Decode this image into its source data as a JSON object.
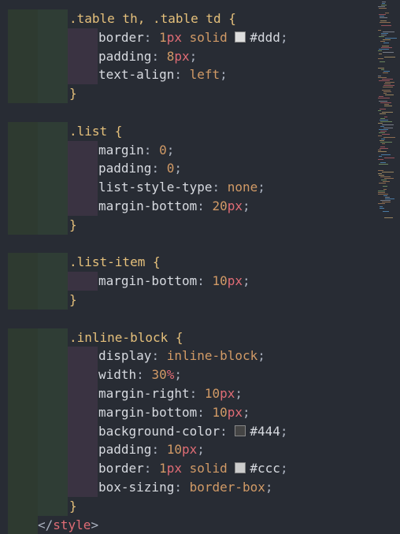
{
  "colors": {
    "background": "#282c34",
    "selector": "#e5c07b",
    "property": "#d7dae0",
    "number": "#d19a66",
    "unit": "#e06c75",
    "keyword": "#d19a66",
    "tag": "#e06c75"
  },
  "lines": [
    {
      "indent": 1,
      "parts": [
        {
          "t": ".table th, .table td ",
          "c": "sel"
        },
        {
          "t": "{",
          "c": "brace"
        }
      ]
    },
    {
      "indent": 2,
      "parts": [
        {
          "t": "border",
          "c": "prop"
        },
        {
          "t": ": ",
          "c": "punct"
        },
        {
          "t": "1",
          "c": "num"
        },
        {
          "t": "px",
          "c": "unit"
        },
        {
          "t": " solid ",
          "c": "kw"
        },
        {
          "sw": "#dddddd"
        },
        {
          "t": "#ddd",
          "c": "hex"
        },
        {
          "t": ";",
          "c": "punct"
        }
      ]
    },
    {
      "indent": 2,
      "parts": [
        {
          "t": "padding",
          "c": "prop"
        },
        {
          "t": ": ",
          "c": "punct"
        },
        {
          "t": "8",
          "c": "num"
        },
        {
          "t": "px",
          "c": "unit"
        },
        {
          "t": ";",
          "c": "punct"
        }
      ]
    },
    {
      "indent": 2,
      "parts": [
        {
          "t": "text-align",
          "c": "prop"
        },
        {
          "t": ": ",
          "c": "punct"
        },
        {
          "t": "left",
          "c": "kw"
        },
        {
          "t": ";",
          "c": "punct"
        }
      ]
    },
    {
      "indent": 1,
      "parts": [
        {
          "t": "}",
          "c": "brace"
        }
      ]
    },
    {
      "indent": 0,
      "parts": []
    },
    {
      "indent": 1,
      "parts": [
        {
          "t": ".list ",
          "c": "sel"
        },
        {
          "t": "{",
          "c": "brace"
        }
      ]
    },
    {
      "indent": 2,
      "parts": [
        {
          "t": "margin",
          "c": "prop"
        },
        {
          "t": ": ",
          "c": "punct"
        },
        {
          "t": "0",
          "c": "num"
        },
        {
          "t": ";",
          "c": "punct"
        }
      ]
    },
    {
      "indent": 2,
      "parts": [
        {
          "t": "padding",
          "c": "prop"
        },
        {
          "t": ": ",
          "c": "punct"
        },
        {
          "t": "0",
          "c": "num"
        },
        {
          "t": ";",
          "c": "punct"
        }
      ]
    },
    {
      "indent": 2,
      "parts": [
        {
          "t": "list-style-type",
          "c": "prop"
        },
        {
          "t": ": ",
          "c": "punct"
        },
        {
          "t": "none",
          "c": "kw"
        },
        {
          "t": ";",
          "c": "punct"
        }
      ]
    },
    {
      "indent": 2,
      "parts": [
        {
          "t": "margin-bottom",
          "c": "prop"
        },
        {
          "t": ": ",
          "c": "punct"
        },
        {
          "t": "20",
          "c": "num"
        },
        {
          "t": "px",
          "c": "unit"
        },
        {
          "t": ";",
          "c": "punct"
        }
      ]
    },
    {
      "indent": 1,
      "parts": [
        {
          "t": "}",
          "c": "brace"
        }
      ]
    },
    {
      "indent": 0,
      "parts": []
    },
    {
      "indent": 1,
      "parts": [
        {
          "t": ".list-item ",
          "c": "sel"
        },
        {
          "t": "{",
          "c": "brace"
        }
      ]
    },
    {
      "indent": 2,
      "parts": [
        {
          "t": "margin-bottom",
          "c": "prop"
        },
        {
          "t": ": ",
          "c": "punct"
        },
        {
          "t": "10",
          "c": "num"
        },
        {
          "t": "px",
          "c": "unit"
        },
        {
          "t": ";",
          "c": "punct"
        }
      ]
    },
    {
      "indent": 1,
      "parts": [
        {
          "t": "}",
          "c": "brace"
        }
      ]
    },
    {
      "indent": 0,
      "parts": []
    },
    {
      "indent": 1,
      "parts": [
        {
          "t": ".inline-block ",
          "c": "sel"
        },
        {
          "t": "{",
          "c": "brace"
        }
      ]
    },
    {
      "indent": 2,
      "parts": [
        {
          "t": "display",
          "c": "prop"
        },
        {
          "t": ": ",
          "c": "punct"
        },
        {
          "t": "inline-block",
          "c": "kw"
        },
        {
          "t": ";",
          "c": "punct"
        }
      ]
    },
    {
      "indent": 2,
      "parts": [
        {
          "t": "width",
          "c": "prop"
        },
        {
          "t": ": ",
          "c": "punct"
        },
        {
          "t": "30",
          "c": "num"
        },
        {
          "t": "%",
          "c": "unit"
        },
        {
          "t": ";",
          "c": "punct"
        }
      ]
    },
    {
      "indent": 2,
      "parts": [
        {
          "t": "margin-right",
          "c": "prop"
        },
        {
          "t": ": ",
          "c": "punct"
        },
        {
          "t": "10",
          "c": "num"
        },
        {
          "t": "px",
          "c": "unit"
        },
        {
          "t": ";",
          "c": "punct"
        }
      ]
    },
    {
      "indent": 2,
      "parts": [
        {
          "t": "margin-bottom",
          "c": "prop"
        },
        {
          "t": ": ",
          "c": "punct"
        },
        {
          "t": "10",
          "c": "num"
        },
        {
          "t": "px",
          "c": "unit"
        },
        {
          "t": ";",
          "c": "punct"
        }
      ]
    },
    {
      "indent": 2,
      "parts": [
        {
          "t": "background-color",
          "c": "prop"
        },
        {
          "t": ": ",
          "c": "punct"
        },
        {
          "sw": "#444444"
        },
        {
          "t": "#444",
          "c": "hex"
        },
        {
          "t": ";",
          "c": "punct"
        }
      ]
    },
    {
      "indent": 2,
      "parts": [
        {
          "t": "padding",
          "c": "prop"
        },
        {
          "t": ": ",
          "c": "punct"
        },
        {
          "t": "10",
          "c": "num"
        },
        {
          "t": "px",
          "c": "unit"
        },
        {
          "t": ";",
          "c": "punct"
        }
      ]
    },
    {
      "indent": 2,
      "parts": [
        {
          "t": "border",
          "c": "prop"
        },
        {
          "t": ": ",
          "c": "punct"
        },
        {
          "t": "1",
          "c": "num"
        },
        {
          "t": "px",
          "c": "unit"
        },
        {
          "t": " solid ",
          "c": "kw"
        },
        {
          "sw": "#cccccc"
        },
        {
          "t": "#ccc",
          "c": "hex"
        },
        {
          "t": ";",
          "c": "punct"
        }
      ]
    },
    {
      "indent": 2,
      "parts": [
        {
          "t": "box-sizing",
          "c": "prop"
        },
        {
          "t": ": ",
          "c": "punct"
        },
        {
          "t": "border-box",
          "c": "kw"
        },
        {
          "t": ";",
          "c": "punct"
        }
      ]
    },
    {
      "indent": 1,
      "parts": [
        {
          "t": "}",
          "c": "brace"
        }
      ]
    },
    {
      "indent": -1,
      "parts": [
        {
          "t": "</",
          "c": "punct"
        },
        {
          "t": "style",
          "c": "tag"
        },
        {
          "t": ">",
          "c": "punct"
        }
      ]
    }
  ]
}
